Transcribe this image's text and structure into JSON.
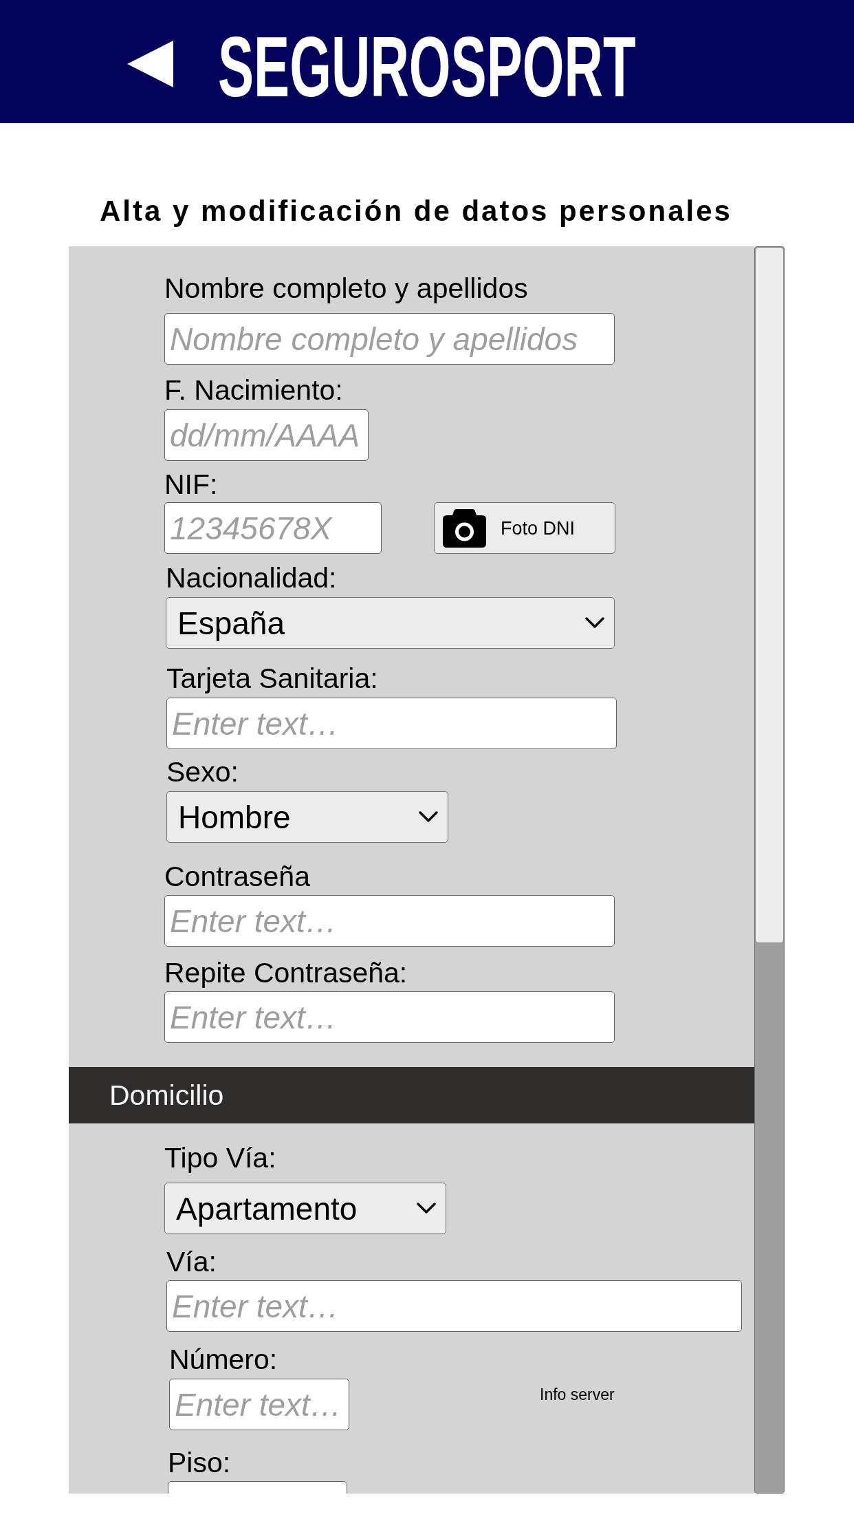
{
  "header": {
    "title": "SEGUROSPORT"
  },
  "page_title": "Alta y modificación de datos personales",
  "form": {
    "items": [
      {
        "kind": "input",
        "label": "Nombre completo y apellidos",
        "placeholder": "Nombre completo y apellidos"
      },
      {
        "kind": "input",
        "label": "F. Nacimiento:",
        "placeholder": "dd/mm/AAAA"
      },
      {
        "kind": "input",
        "label": "NIF:",
        "placeholder": "12345678X",
        "button": "Foto DNI"
      },
      {
        "kind": "select",
        "label": "Nacionalidad:",
        "value": "España"
      },
      {
        "kind": "input",
        "label": "Tarjeta Sanitaria:",
        "placeholder": "Enter text…"
      },
      {
        "kind": "select",
        "label": "Sexo:",
        "value": "Hombre"
      },
      {
        "kind": "input",
        "label": "Contraseña",
        "placeholder": "Enter text…"
      },
      {
        "kind": "input",
        "label": "Repite Contraseña:",
        "placeholder": "Enter text…"
      },
      {
        "kind": "section",
        "title": "Domicilio"
      },
      {
        "kind": "select",
        "label": "Tipo Vía:",
        "value": "Apartamento"
      },
      {
        "kind": "input",
        "label": "Vía:",
        "placeholder": "Enter text…"
      },
      {
        "kind": "input",
        "label": "Número:",
        "placeholder": "Enter text…",
        "note": "Info server"
      },
      {
        "kind": "input",
        "label": "Piso:"
      }
    ]
  }
}
